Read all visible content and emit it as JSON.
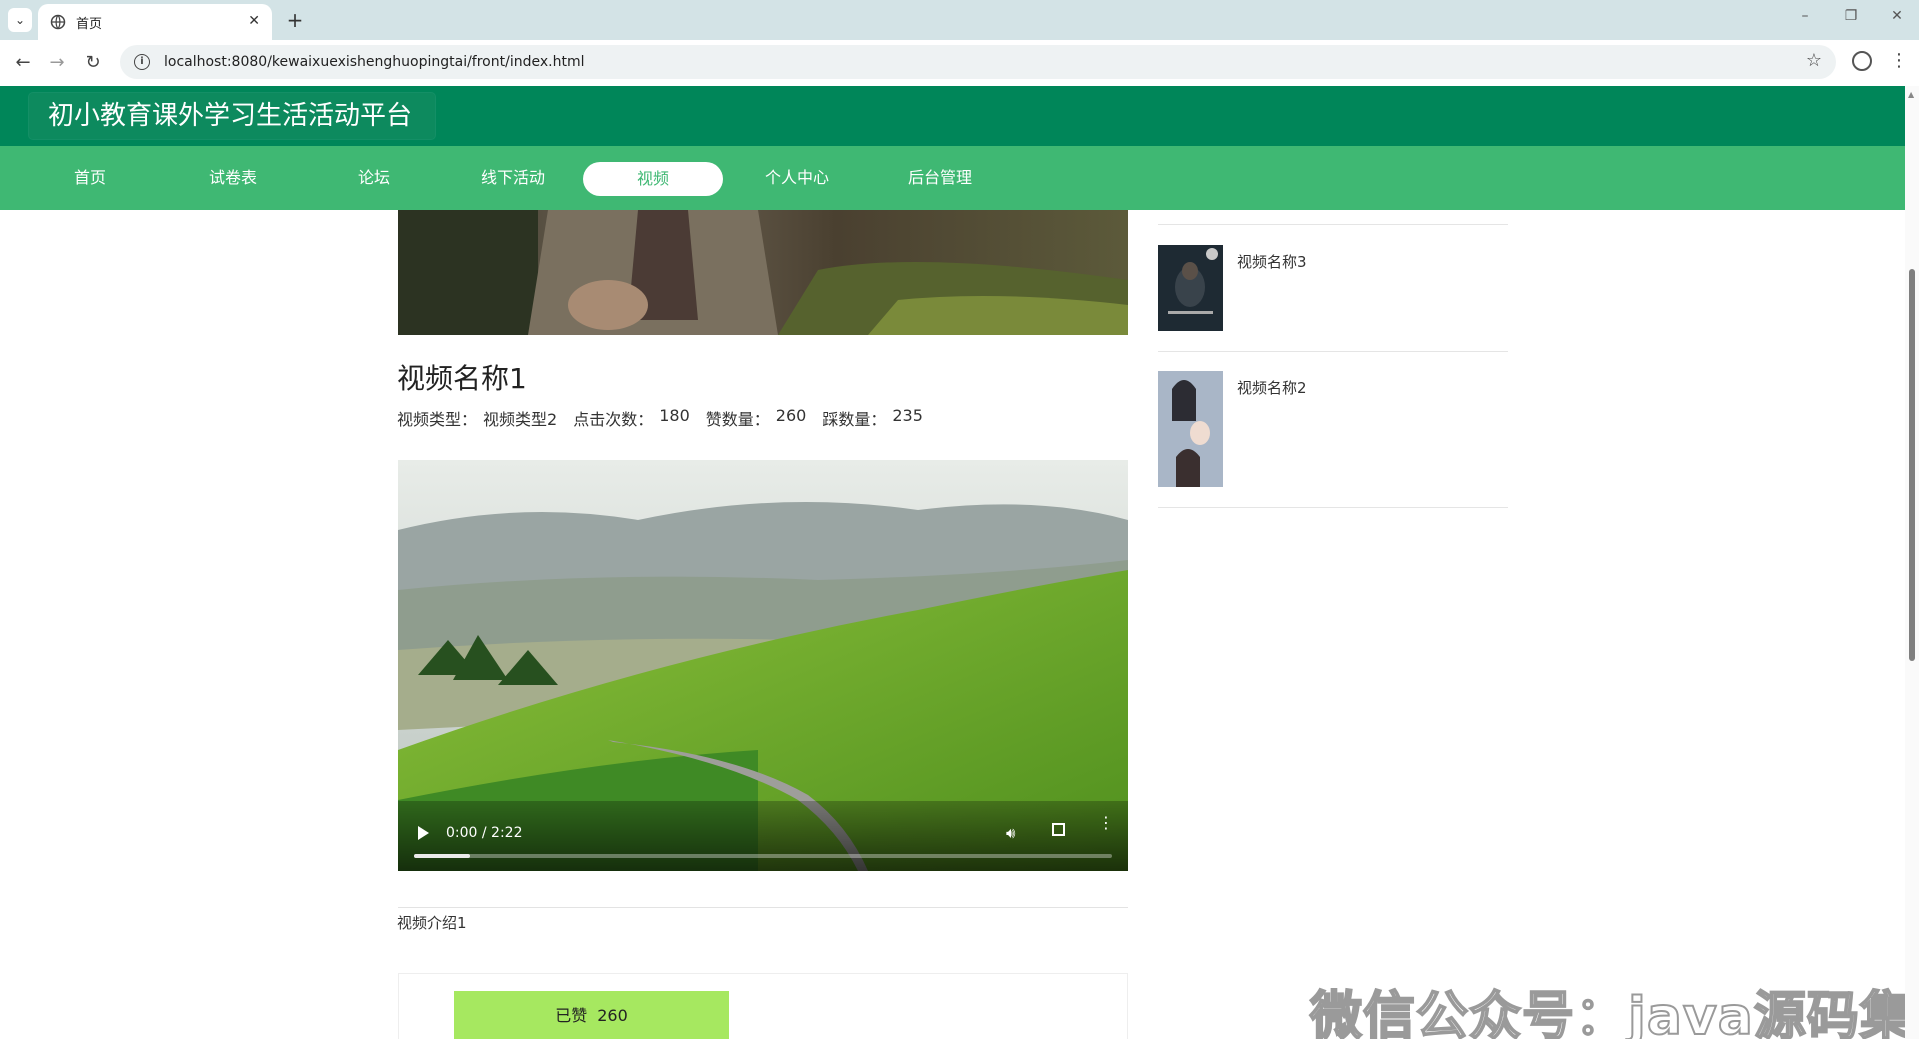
{
  "browser": {
    "tab_title": "首页",
    "url": "localhost:8080/kewaixuexishenghuopingtai/front/index.html"
  },
  "site": {
    "title": "初小教育课外学习生活活动平台",
    "nav": [
      {
        "label": "首页"
      },
      {
        "label": "试卷表"
      },
      {
        "label": "论坛"
      },
      {
        "label": "线下活动"
      },
      {
        "label": "视频",
        "active": true
      },
      {
        "label": "个人中心"
      },
      {
        "label": "后台管理"
      }
    ],
    "accent_color": "#3fb873",
    "header_color": "#008659"
  },
  "video": {
    "title": "视频名称1",
    "meta": {
      "type_label": "视频类型：",
      "type_value": "视频类型2",
      "clicks_label": "点击次数：",
      "clicks_value": "180",
      "likes_label": "赞数量：",
      "likes_value": "260",
      "dislikes_label": "踩数量：",
      "dislikes_value": "235"
    },
    "player": {
      "time": "0:00 / 2:22",
      "progress_fraction": 0.08
    },
    "intro": "视频介绍1",
    "like_button": {
      "label": "已赞",
      "count": "260"
    }
  },
  "sidebar": {
    "items": [
      {
        "name": "视频名称3"
      },
      {
        "name": "视频名称2"
      }
    ]
  },
  "watermark": "微信公众号：java源码集合"
}
